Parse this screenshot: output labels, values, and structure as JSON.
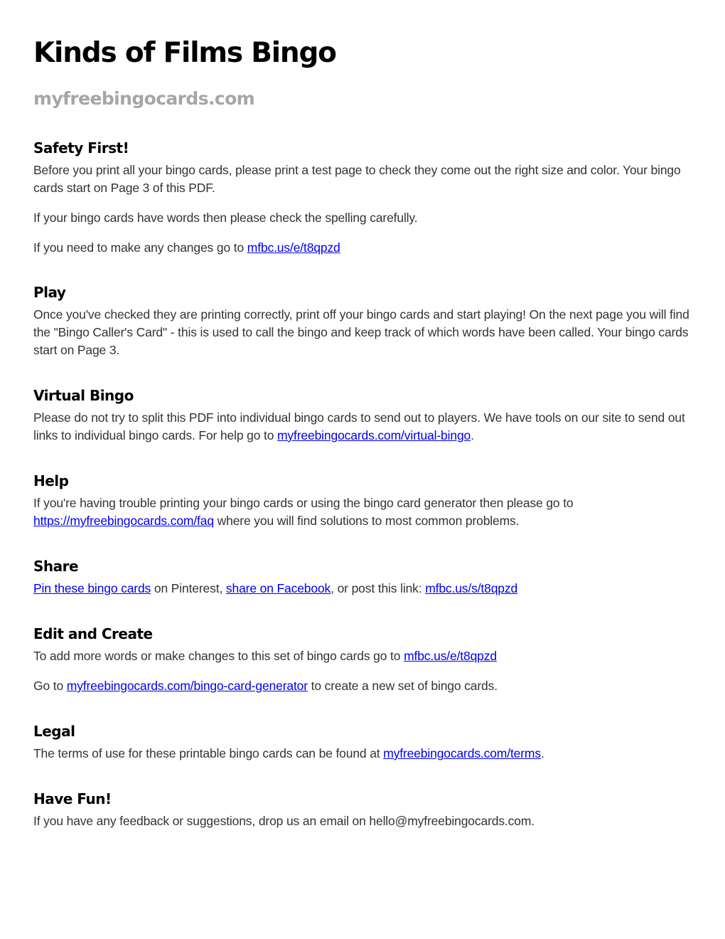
{
  "header": {
    "title": "Kinds of Films Bingo",
    "subtitle": "myfreebingocards.com"
  },
  "colors": {
    "heading": "#000000",
    "subtitle": "#a6a6a6",
    "body_text": "#333333",
    "link": "#0000ee"
  },
  "sections": {
    "safety": {
      "heading": "Safety First!",
      "p1": "Before you print all your bingo cards, please print a test page to check they come out the right size and color. Your bingo cards start on Page 3 of this PDF.",
      "p2": "If your bingo cards have words then please check the spelling carefully.",
      "p3_prefix": "If you need to make any changes go to ",
      "p3_link": "mfbc.us/e/t8qpzd"
    },
    "play": {
      "heading": "Play",
      "p1": "Once you've checked they are printing correctly, print off your bingo cards and start playing! On the next page you will find the \"Bingo Caller's Card\" - this is used to call the bingo and keep track of which words have been called. Your bingo cards start on Page 3."
    },
    "virtual": {
      "heading": "Virtual Bingo",
      "p1_prefix": "Please do not try to split this PDF into individual bingo cards to send out to players. We have tools on our site to send out links to individual bingo cards. For help go to ",
      "p1_link": "myfreebingocards.com/virtual-bingo",
      "p1_suffix": "."
    },
    "help": {
      "heading": "Help",
      "p1_prefix": "If you're having trouble printing your bingo cards or using the bingo card generator then please go to ",
      "p1_link": "https://myfreebingocards.com/faq",
      "p1_suffix": " where you will find solutions to most common problems."
    },
    "share": {
      "heading": "Share",
      "link1": "Pin these bingo cards",
      "text1": " on Pinterest, ",
      "link2": "share on Facebook",
      "text2": ", or post this link: ",
      "link3": "mfbc.us/s/t8qpzd"
    },
    "edit": {
      "heading": "Edit and Create",
      "p1_prefix": "To add more words or make changes to this set of bingo cards go to ",
      "p1_link": "mfbc.us/e/t8qpzd",
      "p2_prefix": "Go to ",
      "p2_link": "myfreebingocards.com/bingo-card-generator",
      "p2_suffix": " to create a new set of bingo cards."
    },
    "legal": {
      "heading": "Legal",
      "p1_prefix": "The terms of use for these printable bingo cards can be found at ",
      "p1_link": "myfreebingocards.com/terms",
      "p1_suffix": "."
    },
    "fun": {
      "heading": "Have Fun!",
      "p1": "If you have any feedback or suggestions, drop us an email on hello@myfreebingocards.com."
    }
  }
}
